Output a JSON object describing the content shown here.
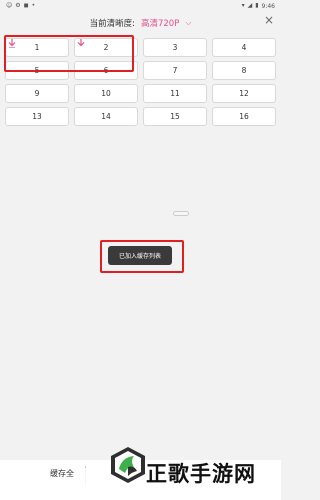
{
  "status_bar": {
    "left_items": [
      "☺",
      "⚙",
      "◼",
      "•"
    ],
    "time": "9:46"
  },
  "header": {
    "label": "当前清晰度:",
    "quality": "高清720P",
    "accent_color": "#e8508a"
  },
  "episodes": [
    {
      "label": "1",
      "downloading": true
    },
    {
      "label": "2",
      "downloading": true
    },
    {
      "label": "3",
      "downloading": false
    },
    {
      "label": "4",
      "downloading": false
    },
    {
      "label": "5",
      "downloading": false
    },
    {
      "label": "6",
      "downloading": false
    },
    {
      "label": "7",
      "downloading": false
    },
    {
      "label": "8",
      "downloading": false
    },
    {
      "label": "9",
      "downloading": false
    },
    {
      "label": "10",
      "downloading": false
    },
    {
      "label": "11",
      "downloading": false
    },
    {
      "label": "12",
      "downloading": false
    },
    {
      "label": "13",
      "downloading": false
    },
    {
      "label": "14",
      "downloading": false
    },
    {
      "label": "15",
      "downloading": false
    },
    {
      "label": "16",
      "downloading": false
    }
  ],
  "toast": {
    "text": "已加入缓存列表"
  },
  "bottom": {
    "cache_all_label": "缓存全"
  },
  "watermark": {
    "text": "正歌手游网"
  },
  "colors": {
    "highlight_red": "#e02020",
    "download_pink": "#e8508a"
  }
}
